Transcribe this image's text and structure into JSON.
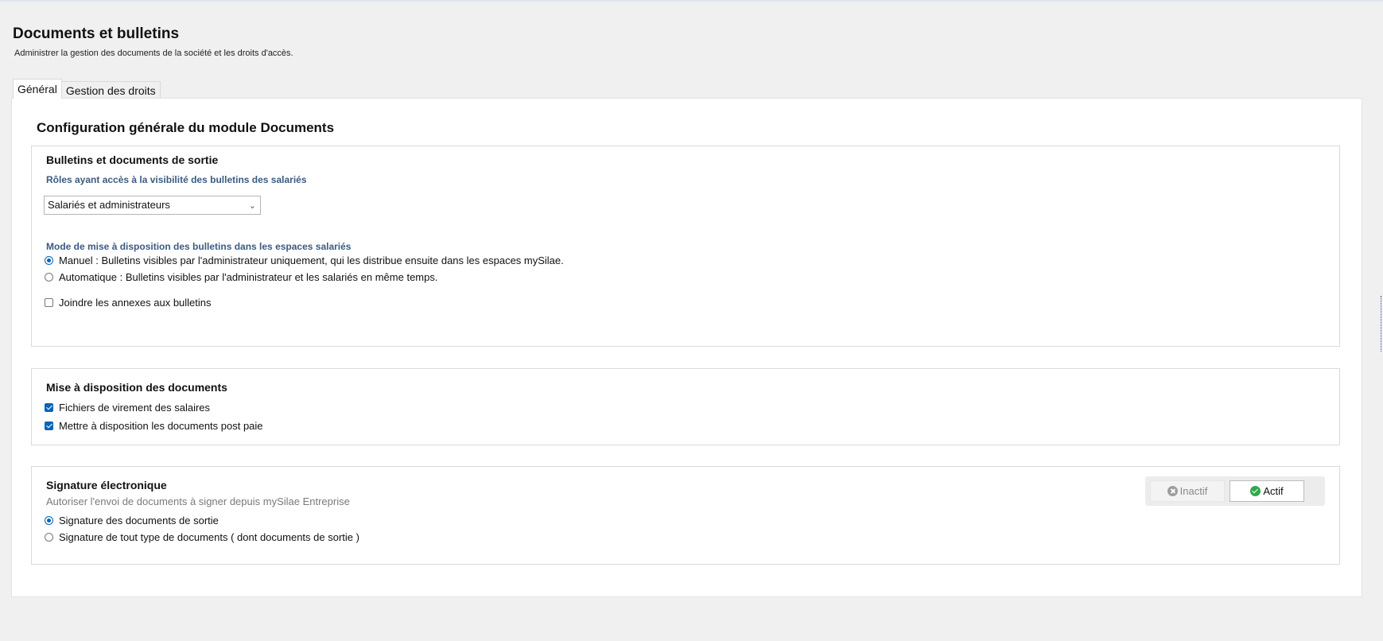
{
  "header": {
    "title": "Documents et bulletins",
    "subtitle": "Administrer la gestion des documents de la société et les droits d'accès."
  },
  "tabs": [
    {
      "label": "Général",
      "active": true
    },
    {
      "label": "Gestion des droits",
      "active": false
    }
  ],
  "main": {
    "title": "Configuration générale du module Documents",
    "bulletins": {
      "title": "Bulletins et documents de sortie",
      "roles_label": "Rôles ayant accès à la visibilité des bulletins des salariés",
      "roles_selected": "Salariés et administrateurs",
      "mode_label": "Mode de mise à disposition des bulletins dans les espaces salariés",
      "mode_options": [
        {
          "label": "Manuel : Bulletins visibles par l'administrateur uniquement, qui les distribue ensuite dans les espaces mySilae.",
          "selected": true
        },
        {
          "label": "Automatique : Bulletins visibles par l'administrateur et les salariés en même temps.",
          "selected": false
        }
      ],
      "attach_annexes": {
        "label": "Joindre les annexes aux bulletins",
        "checked": false
      }
    },
    "documents": {
      "title": "Mise à disposition des documents",
      "options": [
        {
          "label": "Fichiers de virement des salaires",
          "checked": true
        },
        {
          "label": "Mettre à disposition les documents post paie",
          "checked": true
        }
      ]
    },
    "signature": {
      "title": "Signature électronique",
      "description": "Autoriser l'envoi de documents à signer depuis mySilae Entreprise",
      "toggle_off_label": "Inactif",
      "toggle_on_label": "Actif",
      "active": true,
      "options": [
        {
          "label": "Signature des documents de sortie",
          "selected": true
        },
        {
          "label": "Signature de tout type de documents ( dont documents de sortie )",
          "selected": false
        }
      ]
    }
  },
  "colors": {
    "accent": "#0a64b4",
    "label_blue": "#3c5a82",
    "success": "#2fa84a"
  }
}
